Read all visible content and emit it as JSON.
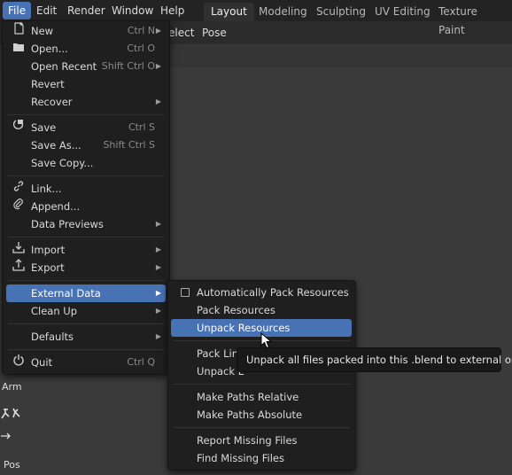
{
  "topbar": {
    "menus": [
      "File",
      "Edit",
      "Render",
      "Window",
      "Help"
    ],
    "workspaces": [
      "Layout",
      "Modeling",
      "Sculpting",
      "UV Editing",
      "Texture Paint"
    ],
    "active_workspace": "Layout"
  },
  "header": {
    "select_label": "elect",
    "pose_label": "Pose"
  },
  "left_toolbar": {
    "arm_label": "Arm",
    "pos_label": "Pos"
  },
  "file_menu": {
    "items": [
      {
        "label": "New",
        "shortcut": "Ctrl N",
        "icon": "new-file-icon",
        "submenu": true
      },
      {
        "label": "Open...",
        "shortcut": "Ctrl O",
        "icon": "folder-icon"
      },
      {
        "label": "Open Recent",
        "shortcut": "Shift Ctrl O",
        "submenu": true
      },
      {
        "label": "Revert"
      },
      {
        "label": "Recover",
        "submenu": true
      },
      {
        "label": "Save",
        "shortcut": "Ctrl S",
        "icon": "save-icon"
      },
      {
        "label": "Save As...",
        "shortcut": "Shift Ctrl S"
      },
      {
        "label": "Save Copy..."
      },
      {
        "label": "Link...",
        "icon": "link-icon"
      },
      {
        "label": "Append...",
        "icon": "paperclip-icon"
      },
      {
        "label": "Data Previews",
        "submenu": true
      },
      {
        "label": "Import",
        "icon": "import-icon",
        "submenu": true
      },
      {
        "label": "Export",
        "icon": "export-icon",
        "submenu": true
      },
      {
        "label": "External Data",
        "submenu": true
      },
      {
        "label": "Clean Up",
        "submenu": true
      },
      {
        "label": "Defaults",
        "submenu": true
      },
      {
        "label": "Quit",
        "shortcut": "Ctrl Q",
        "icon": "power-icon"
      }
    ]
  },
  "external_data_menu": {
    "items": [
      {
        "label": "Automatically Pack Resources",
        "checkbox": true,
        "checked": false
      },
      {
        "label": "Pack Resources"
      },
      {
        "label": "Unpack Resources"
      },
      {
        "label": "Pack Linl"
      },
      {
        "label": "Unpack L"
      },
      {
        "label": "Make Paths Relative"
      },
      {
        "label": "Make Paths Absolute"
      },
      {
        "label": "Report Missing Files"
      },
      {
        "label": "Find Missing Files"
      }
    ]
  },
  "tooltip": {
    "text": "Unpack all files packed into this .blend to external ones."
  },
  "colors": {
    "highlight": "#4772b3",
    "menu_bg": "#1f1f1f",
    "topbar_bg": "#232323"
  }
}
